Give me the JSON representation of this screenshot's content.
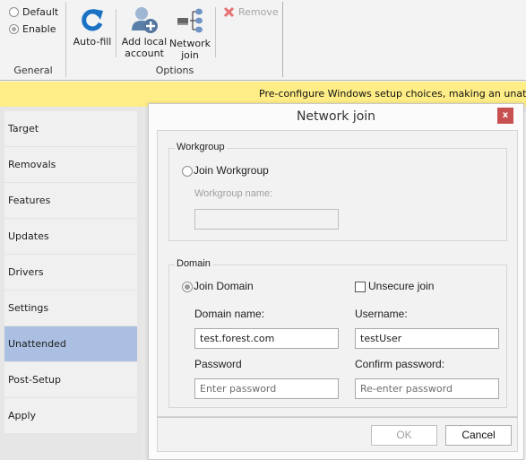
{
  "ribbon": {
    "general": {
      "options": [
        {
          "label": "Default",
          "checked": false
        },
        {
          "label": "Enable",
          "checked": true
        }
      ],
      "group_label": "General"
    },
    "options_group": {
      "buttons": [
        {
          "label": "Auto-fill",
          "icon": "refresh-icon"
        },
        {
          "label_line1": "Add local",
          "label_line2": "account",
          "icon": "add-user-icon"
        },
        {
          "label_line1": "Network",
          "label_line2": "join",
          "icon": "network-icon"
        }
      ],
      "remove": {
        "label": "Remove",
        "icon": "close-x-icon",
        "disabled": true
      },
      "group_label": "Options"
    }
  },
  "infobar": {
    "text": "Pre-configure Windows setup choices, making an unattended"
  },
  "sidebar": {
    "items": [
      {
        "label": "Target"
      },
      {
        "label": "Removals"
      },
      {
        "label": "Features"
      },
      {
        "label": "Updates"
      },
      {
        "label": "Drivers"
      },
      {
        "label": "Settings"
      },
      {
        "label": "Unattended",
        "active": true
      },
      {
        "label": "Post-Setup"
      },
      {
        "label": "Apply"
      }
    ]
  },
  "dialog": {
    "title": "Network join",
    "close_label": "x",
    "workgroup": {
      "legend": "Workgroup",
      "radio_label": "Join Workgroup",
      "radio_checked": false,
      "name_label": "Workgroup name:",
      "name_value": ""
    },
    "domain": {
      "legend": "Domain",
      "radio_label": "Join Domain",
      "radio_checked": true,
      "unsecure_label": "Unsecure join",
      "unsecure_checked": false,
      "domain_name_label": "Domain name:",
      "domain_name_value": "test.forest.com",
      "username_label": "Username:",
      "username_value": "testUser",
      "password_label": "Password",
      "password_placeholder": "Enter password",
      "confirm_label": "Confirm password:",
      "confirm_placeholder": "Re-enter password"
    },
    "ok_label": "OK",
    "cancel_label": "Cancel"
  }
}
